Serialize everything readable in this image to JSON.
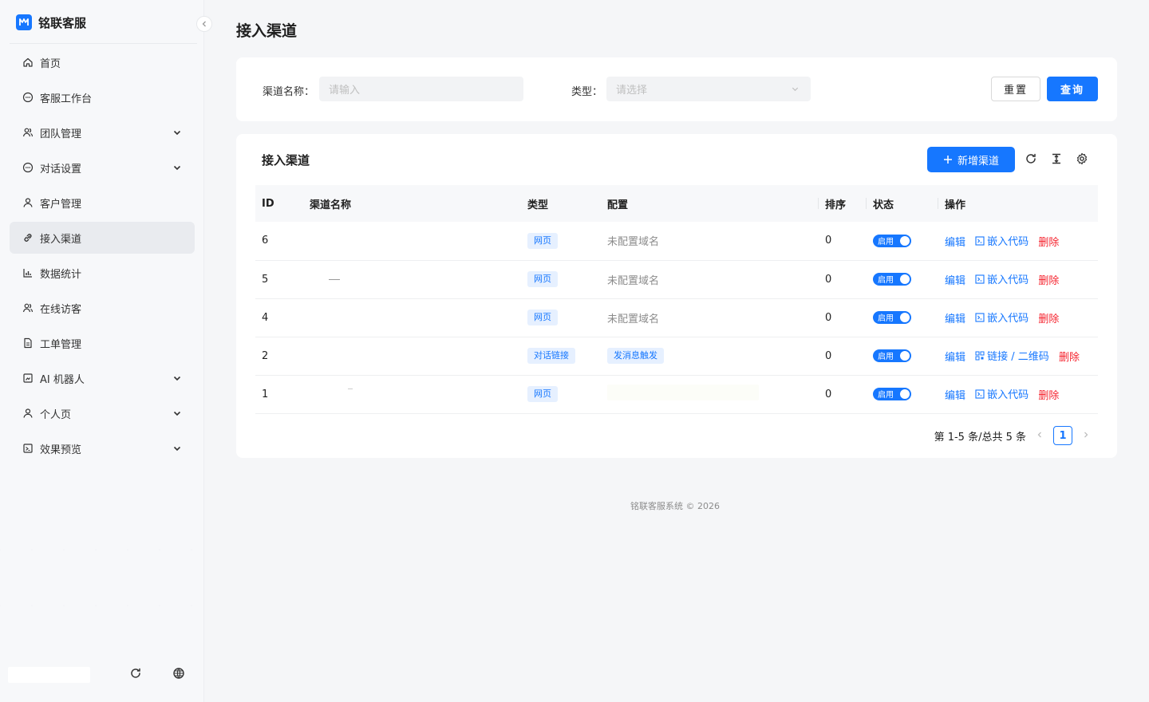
{
  "brand": {
    "name": "铭联客服"
  },
  "sidebar": {
    "items": [
      {
        "label": "首页",
        "icon": "home-icon",
        "expandable": false,
        "active": false
      },
      {
        "label": "客服工作台",
        "icon": "chat-bubble-icon",
        "expandable": false,
        "active": false
      },
      {
        "label": "团队管理",
        "icon": "team-icon",
        "expandable": true,
        "active": false
      },
      {
        "label": "对话设置",
        "icon": "chat-bubble-icon",
        "expandable": true,
        "active": false
      },
      {
        "label": "客户管理",
        "icon": "user-icon",
        "expandable": false,
        "active": false
      },
      {
        "label": "接入渠道",
        "icon": "link-icon",
        "expandable": false,
        "active": true
      },
      {
        "label": "数据统计",
        "icon": "bar-chart-icon",
        "expandable": false,
        "active": false
      },
      {
        "label": "在线访客",
        "icon": "team-icon",
        "expandable": false,
        "active": false
      },
      {
        "label": "工单管理",
        "icon": "document-icon",
        "expandable": false,
        "active": false
      },
      {
        "label": "AI 机器人",
        "icon": "robot-icon",
        "expandable": true,
        "active": false
      },
      {
        "label": "个人页",
        "icon": "user-icon",
        "expandable": true,
        "active": false
      },
      {
        "label": "效果预览",
        "icon": "preview-icon",
        "expandable": true,
        "active": false
      }
    ]
  },
  "page": {
    "title": "接入渠道"
  },
  "search": {
    "name_label": "渠道名称：",
    "name_placeholder": "请输入",
    "type_label": "类型：",
    "type_placeholder": "请选择",
    "reset_label": "重置",
    "query_label": "查询"
  },
  "table": {
    "title": "接入渠道",
    "add_label": "新增渠道",
    "columns": [
      "ID",
      "渠道名称",
      "类型",
      "配置",
      "排序",
      "状态",
      "操作"
    ],
    "rows": [
      {
        "id": "6",
        "type": "网页",
        "config": "未配置域名",
        "sort": "0",
        "status": "启用",
        "actions": [
          "编辑",
          "嵌入代码",
          "删除"
        ]
      },
      {
        "id": "5",
        "type": "网页",
        "config": "未配置域名",
        "sort": "0",
        "status": "启用",
        "actions": [
          "编辑",
          "嵌入代码",
          "删除"
        ]
      },
      {
        "id": "4",
        "type": "网页",
        "config": "未配置域名",
        "sort": "0",
        "status": "启用",
        "actions": [
          "编辑",
          "嵌入代码",
          "删除"
        ]
      },
      {
        "id": "2",
        "type": "对话链接",
        "config": "发消息触发",
        "sort": "0",
        "status": "启用",
        "actions": [
          "编辑",
          "链接 / 二维码",
          "删除"
        ]
      },
      {
        "id": "1",
        "type": "网页",
        "config": "",
        "sort": "0",
        "status": "启用",
        "actions": [
          "编辑",
          "嵌入代码",
          "删除"
        ]
      }
    ],
    "pagination": {
      "summary": "第 1-5 条/总共 5 条",
      "current_page": "1"
    }
  },
  "footer": {
    "copyright": "铭联客服系统 © 2026"
  },
  "colors": {
    "primary": "#1677ff",
    "danger": "#f5222d",
    "tag_bg": "#e6f0ff"
  }
}
